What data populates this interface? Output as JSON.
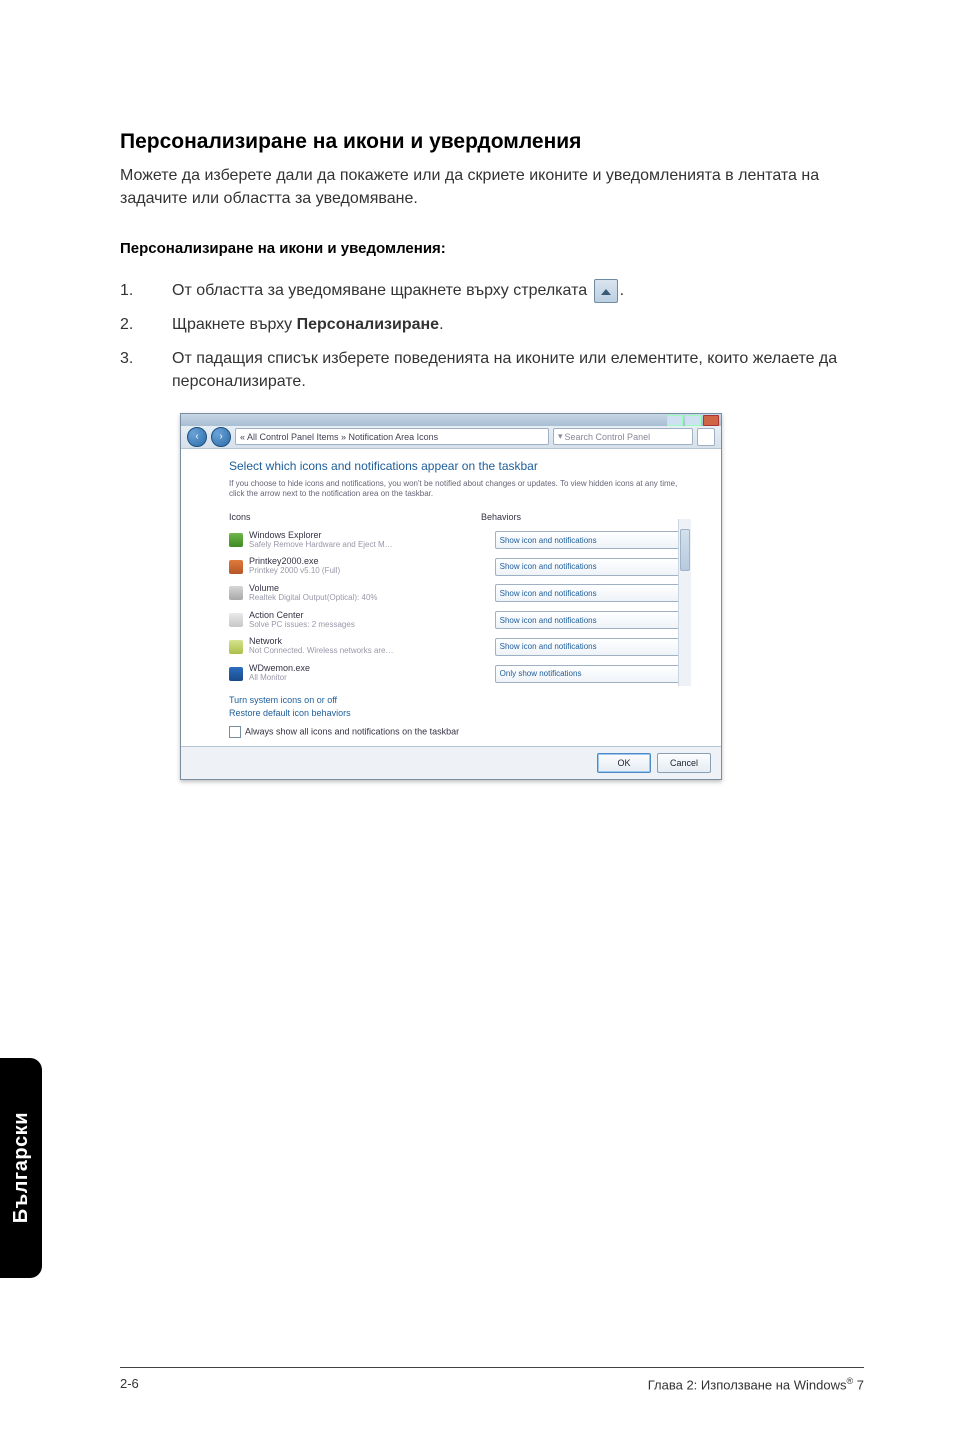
{
  "section": {
    "title": "Персонализиране на икони и увердомления",
    "intro": "Можете да изберете дали да покажете или да скриете иконите и уведомленията в лентата на задачите или областта за уведомяване.",
    "subhead": "Персонализиране на икони и уведомления:"
  },
  "steps": [
    {
      "num": "1.",
      "text_before": "От областта за уведомяване щракнете върху стрелката ",
      "has_icon": true,
      "text_after": "."
    },
    {
      "num": "2.",
      "text_before": "Щракнете върху ",
      "bold": "Персонализиране",
      "text_after": "."
    },
    {
      "num": "3.",
      "text_before": "От падащия списък изберете поведенията на иконите или елементите, които желаете да персонализирате."
    }
  ],
  "window": {
    "breadcrumb": "« All Control Panel Items » Notification Area Icons",
    "search_placeholder": "Search Control Panel",
    "heading": "Select which icons and notifications appear on the taskbar",
    "subtext": "If you choose to hide icons and notifications, you won't be notified about changes or updates. To view hidden icons at any time, click the arrow next to the notification area on the taskbar.",
    "col_icons": "Icons",
    "col_behaviors": "Behaviors",
    "rows": [
      {
        "title": "Windows Explorer",
        "sub": "Safely Remove Hardware and Eject M…",
        "behavior": "Show icon and notifications",
        "icon_color": "linear-gradient(#6fb64b,#3e8a23)"
      },
      {
        "title": "Printkey2000.exe",
        "sub": "Printkey 2000 v5.10 (Full)",
        "behavior": "Show icon and notifications",
        "icon_color": "linear-gradient(#e07a3b,#b5562a)"
      },
      {
        "title": "Volume",
        "sub": "Realtek Digital Output(Optical): 40%",
        "behavior": "Show icon and notifications",
        "icon_color": "linear-gradient(#d6d6d6,#a8a8a8)"
      },
      {
        "title": "Action Center",
        "sub": "Solve PC issues: 2 messages",
        "behavior": "Show icon and notifications",
        "icon_color": "linear-gradient(#e9e9e9,#c7c7c7)"
      },
      {
        "title": "Network",
        "sub": "Not Connected. Wireless networks are…",
        "behavior": "Show icon and notifications",
        "icon_color": "linear-gradient(#d7e28d,#a9bf4a)"
      },
      {
        "title": "WDwemon.exe",
        "sub": "All Monitor",
        "behavior": "Only show notifications",
        "icon_color": "linear-gradient(#2b6dbf,#1a4a8a)"
      }
    ],
    "link1": "Turn system icons on or off",
    "link2": "Restore default icon behaviors",
    "checkbox": "Always show all icons and notifications on the taskbar",
    "ok": "OK",
    "cancel": "Cancel"
  },
  "side_tab": "Български",
  "footer": {
    "left": "2-6",
    "right_prefix": "Глава 2: Използване на Windows",
    "right_suffix": " 7"
  }
}
